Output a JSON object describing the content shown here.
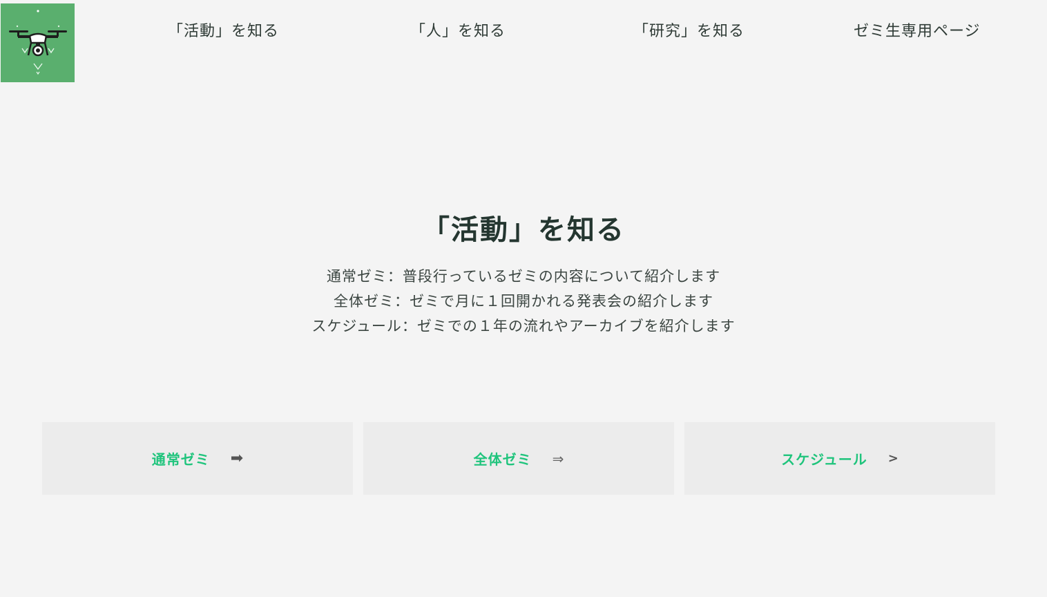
{
  "nav": {
    "items": [
      {
        "label": "「活動」を知る"
      },
      {
        "label": "「人」を知る"
      },
      {
        "label": "「研究」を知る"
      },
      {
        "label": "ゼミ生専用ページ"
      }
    ]
  },
  "hero": {
    "title": "「活動」を知る",
    "lines": [
      "通常ゼミ：普段行っているゼミの内容について紹介します",
      "全体ゼミ：ゼミで月に１回開かれる発表会の紹介します",
      "スケジュール：ゼミでの１年の流れやアーカイブを紹介します"
    ]
  },
  "cards": [
    {
      "label": "通常ゼミ",
      "arrow": "➡"
    },
    {
      "label": "全体ゼミ",
      "arrow": "⇒"
    },
    {
      "label": "スケジュール",
      "arrow": ">"
    }
  ],
  "colors": {
    "background": "#f4f4f4",
    "logo_bg": "#5aaf6e",
    "card_bg": "#ececec",
    "card_text": "#1fc47c",
    "heading_text": "#243630"
  },
  "icons": {
    "logo": "drone-icon"
  }
}
